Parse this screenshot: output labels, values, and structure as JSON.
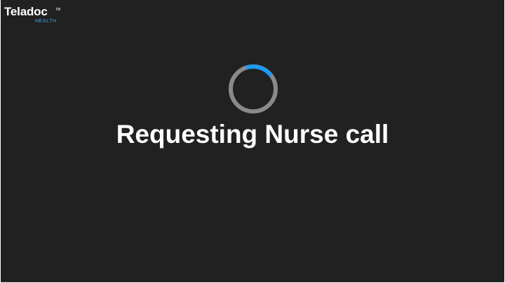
{
  "logo": {
    "wordmark": "Teladoc",
    "trademark": "TM",
    "subtitle": "HEALTH"
  },
  "status": {
    "message": "Requesting Nurse call"
  },
  "spinner": {
    "icon": "loading-spinner-icon",
    "progress_fraction": 0.2,
    "track_color": "#8a8a8a",
    "active_color": "#1e9bf0"
  },
  "colors": {
    "background": "#212121",
    "text": "#ffffff",
    "brand_accent": "#3fa9e0"
  }
}
